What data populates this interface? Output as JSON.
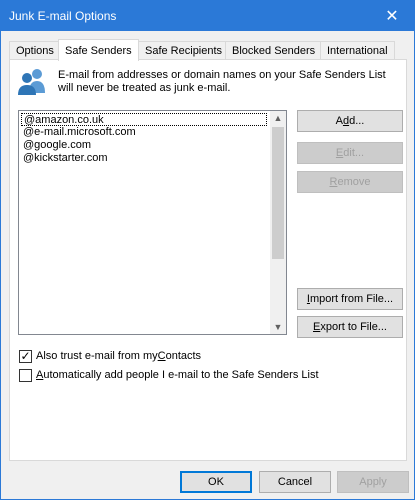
{
  "window": {
    "title": "Junk E-mail Options",
    "close_glyph": "✕"
  },
  "tabs": [
    {
      "label": "Options",
      "active": false
    },
    {
      "label": "Safe Senders",
      "active": true
    },
    {
      "label": "Safe Recipients",
      "active": false
    },
    {
      "label": "Blocked Senders",
      "active": false
    },
    {
      "label": "International",
      "active": false
    }
  ],
  "panel": {
    "icon": "people-icon",
    "description": "E-mail from addresses or domain names on your Safe Senders List will never be treated as junk e-mail.",
    "list_items": [
      "@amazon.co.uk",
      "@e-mail.microsoft.com",
      "@google.com",
      "@kickstarter.com"
    ],
    "buttons": {
      "add": {
        "pre": "A",
        "u": "d",
        "post": "d..."
      },
      "edit": {
        "pre": "",
        "u": "E",
        "post": "dit..."
      },
      "remove": {
        "pre": "",
        "u": "R",
        "post": "emove"
      },
      "import": {
        "pre": "",
        "u": "I",
        "post": "mport from File..."
      },
      "export": {
        "pre": "",
        "u": "E",
        "post": "xport to File..."
      }
    },
    "checkboxes": {
      "trust_contacts": {
        "pre": "Also trust e-mail from my ",
        "u": "C",
        "post": "ontacts",
        "checked": true
      },
      "auto_add": {
        "pre": "",
        "u": "A",
        "post": "utomatically add people I e-mail to the Safe Senders List",
        "checked": false
      }
    }
  },
  "footer": {
    "ok": "OK",
    "cancel": "Cancel",
    "apply": "Apply"
  },
  "colors": {
    "titlebar": "#2b79d7",
    "accent": "#0078d7"
  }
}
